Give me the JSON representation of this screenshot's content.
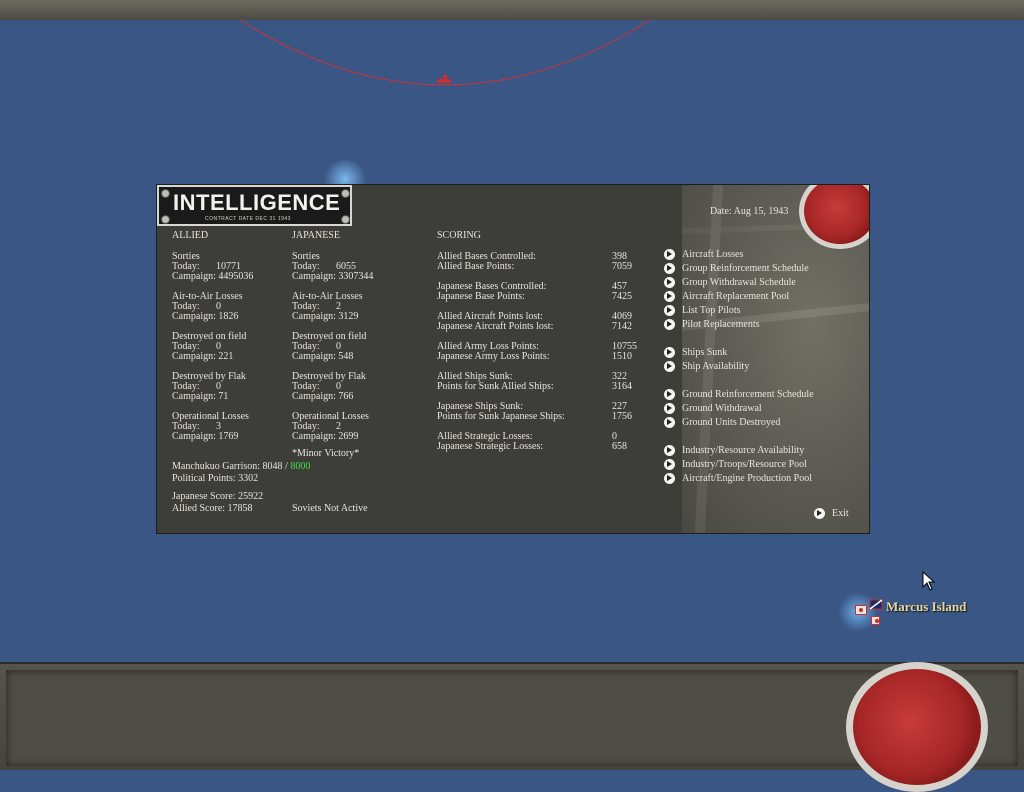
{
  "window": {
    "title": "INTELLIGENCE",
    "subtitle": "CONTRACT DATE DEC 31 1943"
  },
  "date": {
    "label": "Date:",
    "value": "Aug 15, 1943"
  },
  "allied": {
    "header": "ALLIED",
    "sorties": {
      "label": "Sorties",
      "today_label": "Today:",
      "today": "10771",
      "campaign_label": "Campaign:",
      "campaign": "4495036"
    },
    "air_to_air": {
      "label": "Air-to-Air Losses",
      "today_label": "Today:",
      "today": "0",
      "campaign_label": "Campaign:",
      "campaign": "1826"
    },
    "destroyed_field": {
      "label": "Destroyed on field",
      "today_label": "Today:",
      "today": "0",
      "campaign_label": "Campaign:",
      "campaign": "221"
    },
    "destroyed_flak": {
      "label": "Destroyed by Flak",
      "today_label": "Today:",
      "today": "0",
      "campaign_label": "Campaign:",
      "campaign": "71"
    },
    "operational": {
      "label": "Operational Losses",
      "today_label": "Today:",
      "today": "3",
      "campaign_label": "Campaign:",
      "campaign": "1769"
    }
  },
  "japanese": {
    "header": "JAPANESE",
    "sorties": {
      "label": "Sorties",
      "today_label": "Today:",
      "today": "6055",
      "campaign_label": "Campaign:",
      "campaign": "3307344"
    },
    "air_to_air": {
      "label": "Air-to-Air Losses",
      "today_label": "Today:",
      "today": "2",
      "campaign_label": "Campaign:",
      "campaign": "3129"
    },
    "destroyed_field": {
      "label": "Destroyed on field",
      "today_label": "Today:",
      "today": "0",
      "campaign_label": "Campaign:",
      "campaign": "548"
    },
    "destroyed_flak": {
      "label": "Destroyed by Flak",
      "today_label": "Today:",
      "today": "0",
      "campaign_label": "Campaign:",
      "campaign": "766"
    },
    "operational": {
      "label": "Operational Losses",
      "today_label": "Today:",
      "today": "2",
      "campaign_label": "Campaign:",
      "campaign": "2699"
    }
  },
  "summary": {
    "victory": "*Minor Victory*",
    "manchukuo_label": "Manchukuo Garrison:",
    "manchukuo_current": "8048 /",
    "manchukuo_required": "8000",
    "political_points": "Political Points: 3302",
    "japanese_score": "Japanese Score: 25922",
    "allied_score": "Allied Score: 17858",
    "soviets": "Soviets Not Active"
  },
  "scoring": {
    "header": "SCORING",
    "rows": [
      {
        "label": "Allied Bases Controlled:",
        "value": "398"
      },
      {
        "label": "Allied Base Points:",
        "value": "7059"
      },
      {
        "label": "Japanese Bases Controlled:",
        "value": "457"
      },
      {
        "label": "Japanese Base Points:",
        "value": "7425"
      },
      {
        "label": "Allied Aircraft Points lost:",
        "value": "4069"
      },
      {
        "label": "Japanese Aircraft Points lost:",
        "value": "7142"
      },
      {
        "label": "Allied Army Loss Points:",
        "value": "10755"
      },
      {
        "label": "Japanese Army Loss Points:",
        "value": "1510"
      },
      {
        "label": "Allied Ships Sunk:",
        "value": "322"
      },
      {
        "label": "Points for Sunk Allied Ships:",
        "value": "3164"
      },
      {
        "label": "Japanese Ships Sunk:",
        "value": "227"
      },
      {
        "label": "Points for Sunk Japanese Ships:",
        "value": "1756"
      },
      {
        "label": "Allied Strategic Losses:",
        "value": "0"
      },
      {
        "label": "Japanese Strategic Losses:",
        "value": "658"
      }
    ]
  },
  "menu": [
    "Aircraft Losses",
    "Group Reinforcement Schedule",
    "Group Withdrawal Schedule",
    "Aircraft Replacement Pool",
    "List Top Pilots",
    "Pilot Replacements",
    "Ships Sunk",
    "Ship Availability",
    "Ground Reinforcement Schedule",
    "Ground Withdrawal",
    "Ground Units Destroyed",
    "Industry/Resource Availability",
    "Industry/Troops/Resource Pool",
    "Aircraft/Engine Production Pool"
  ],
  "exit_label": "Exit",
  "map": {
    "island_name": "Marcus Island"
  },
  "colors": {
    "sea": "#3a5685",
    "panel": "#3d3d3a",
    "green": "#3de33d",
    "island_label": "#e6d69a"
  }
}
